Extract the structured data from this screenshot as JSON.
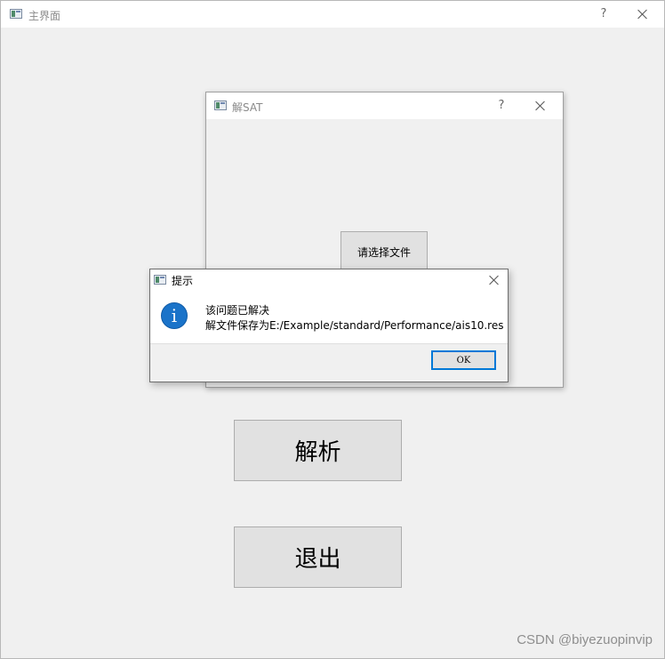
{
  "main_window": {
    "title": "主界面",
    "help_glyph": "?",
    "close_icon": "close-icon",
    "buttons": {
      "parse_label": "解析",
      "exit_label": "退出"
    }
  },
  "sat_window": {
    "title": "解SAT",
    "help_glyph": "?",
    "close_icon": "close-icon",
    "select_file_label": "请选择文件"
  },
  "message_box": {
    "title": "提示",
    "icon": "info-icon",
    "icon_glyph": "i",
    "line1": "该问题已解决",
    "line2": "解文件保存为E:/Example/standard/Performance/ais10.res",
    "ok_label": "OK"
  },
  "watermark": "CSDN @biyezuopinvip",
  "colors": {
    "accent": "#0078d7",
    "info_icon": "#1a73c9",
    "window_bg": "#f0f0f0",
    "button_bg": "#e1e1e1"
  }
}
